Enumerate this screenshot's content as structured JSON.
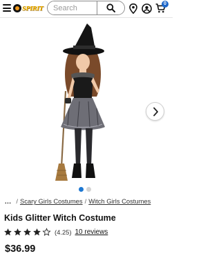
{
  "header": {
    "logo_text": "SPIRIT",
    "search_placeholder": "Search",
    "cart_count": "0"
  },
  "icons": {
    "menu": "hamburger-menu-icon",
    "search": "magnifier-icon",
    "store": "location-pin-icon",
    "account": "user-circle-icon",
    "cart": "shopping-cart-icon",
    "next": "chevron-right-icon"
  },
  "gallery": {
    "image_count": 2,
    "active_index": 0
  },
  "breadcrumb": {
    "more": "...",
    "items": [
      "Scary Girls Costumes",
      "Witch Girls Costumes"
    ],
    "separator": "/"
  },
  "product": {
    "title": "Kids Glitter Witch Costume",
    "rating_value": "(4.25)",
    "rating_stars": 4.25,
    "reviews_text": "10 reviews",
    "price": "$36.99"
  },
  "colors": {
    "badge": "#1e67c9",
    "active_dot": "#1e78d2",
    "logo": "#f5b800"
  }
}
